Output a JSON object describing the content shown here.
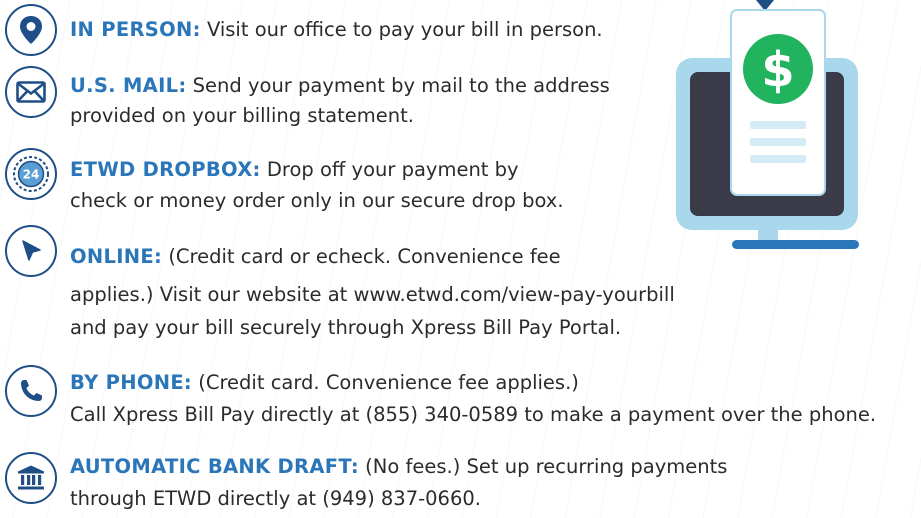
{
  "items": [
    {
      "icon": "location-pin-icon",
      "heading": "IN PERSON:",
      "lines": [
        "Visit our office to pay your bill in person."
      ]
    },
    {
      "icon": "envelope-icon",
      "heading": "U.S. MAIL:",
      "lines": [
        "Send your payment by mail to the address",
        "provided on your billing statement."
      ]
    },
    {
      "icon": "dropbox-24-icon",
      "icon_text": "24",
      "heading": "ETWD DROPBOX:",
      "lines": [
        "Drop off your payment by",
        "check or money order only in our secure drop box."
      ]
    },
    {
      "icon": "cursor-icon",
      "heading": "ONLINE:",
      "lines": [
        "(Credit card or echeck. Convenience fee",
        "applies.) Visit our website at www.etwd.com/view-pay-yourbill",
        "and pay your bill securely through Xpress Bill Pay Portal."
      ]
    },
    {
      "icon": "phone-icon",
      "heading": "BY PHONE:",
      "lines": [
        "(Credit card. Convenience fee applies.)",
        "Call Xpress Bill Pay directly at (855) 340-0589 to make a payment over the phone."
      ]
    },
    {
      "icon": "bank-icon",
      "heading": "AUTOMATIC BANK DRAFT:",
      "lines": [
        "(No fees.) Set up recurring payments",
        "through ETWD directly at (949) 837-0660."
      ]
    }
  ],
  "illustration": {
    "icon": "monitor-bill-dollar-icon",
    "symbol": "$"
  },
  "colors": {
    "heading": "#2a76b9",
    "icon_outline": "#1f4f86",
    "text": "#2b2b2b",
    "monitor_frame": "#3a3a48",
    "monitor_border": "#a9d8ec",
    "monitor_stand": "#2a76b9",
    "dollar_green": "#22b35e",
    "doc_lines": "#d5ecf6"
  }
}
